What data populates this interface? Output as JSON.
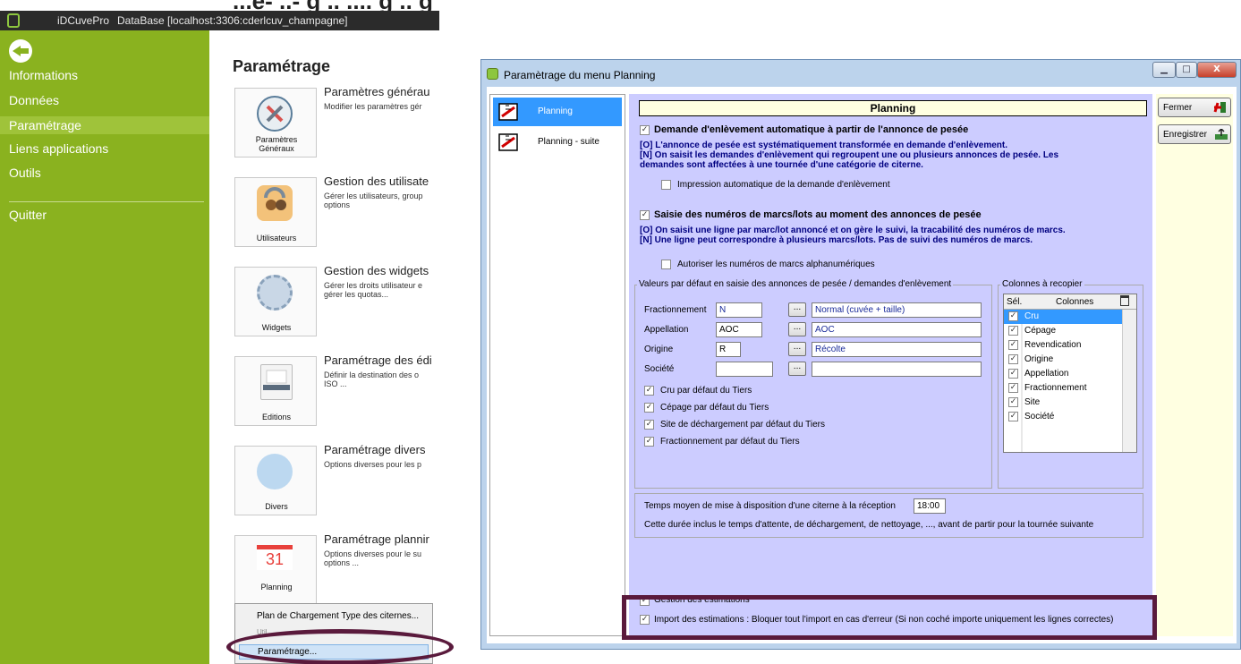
{
  "app": {
    "name": "iDCuvePro",
    "database": "DataBase [localhost:3306:cderlcuv_champagne]",
    "top_crop_text": "...e-  ..- g  ..  .... g  ..  g"
  },
  "sidebar": {
    "items": [
      {
        "label": "Informations"
      },
      {
        "label": "Données"
      },
      {
        "label": "Paramétrage"
      },
      {
        "label": "Liens applications"
      },
      {
        "label": "Outils"
      },
      {
        "label": "Quitter"
      }
    ]
  },
  "main": {
    "title": "Paramétrage",
    "sections": [
      {
        "card_label_line1": "Paramètres",
        "card_label_line2": "Généraux",
        "title": "Paramètres générau",
        "desc_line1": "Modifier les paramètres gér",
        "desc_line2": "",
        "icon": "wrench-screwdriver-icon"
      },
      {
        "card_label_line1": "Utilisateurs",
        "card_label_line2": "",
        "title": "Gestion des utilisate",
        "desc_line1": "Gérer les utilisateurs, group",
        "desc_line2": "options",
        "icon": "users-lock-icon"
      },
      {
        "card_label_line1": "Widgets",
        "card_label_line2": "",
        "title": "Gestion des widgets",
        "desc_line1": "Gérer les droits utilisateur e",
        "desc_line2": "gérer les quotas...",
        "icon": "gear-icon"
      },
      {
        "card_label_line1": "Editions",
        "card_label_line2": "",
        "title": "Paramétrage des édi",
        "desc_line1": "Définir la destination des o",
        "desc_line2": "ISO ...",
        "icon": "printer-icon"
      },
      {
        "card_label_line1": "Divers",
        "card_label_line2": "",
        "title": "Paramétrage divers",
        "desc_line1": "Options diverses pour les p",
        "desc_line2": "",
        "icon": "dots-icon"
      },
      {
        "card_label_line1": "Planning",
        "card_label_line2": "",
        "title": "Paramétrage plannir",
        "desc_line1": "Options diverses pour le su",
        "desc_line2": "options ...",
        "icon": "calendar-icon",
        "calendar_day": "31"
      }
    ],
    "context_menu": {
      "items": [
        {
          "label": "Plan de Chargement Type des citernes..."
        },
        {
          "label": "Util..."
        },
        {
          "label": "Paramétrage..."
        }
      ]
    }
  },
  "dialog": {
    "title": "Paramètrage du menu Planning",
    "window_buttons": {
      "minimize": "▁",
      "maximize": "□",
      "close": "X"
    },
    "nav": [
      {
        "label": "Planning"
      },
      {
        "label": "Planning - suite"
      }
    ],
    "panel": {
      "title": "Planning",
      "demande_auto": {
        "label": "Demande d'enlèvement automatique à partir de l'annonce de pesée",
        "checked": true,
        "note1": "[O] L'annonce de pesée est systématiquement transformée en demande d'enlèvement.",
        "note2": "[N] On saisit les demandes d'enlèvement qui regroupent une ou plusieurs annonces de pesée. Les",
        "note3": "demandes sont affectées à une tournée d'une catégorie de citerne."
      },
      "impression_auto": {
        "label": "Impression automatique de la demande d'enlèvement",
        "checked": false
      },
      "saisie_numeros": {
        "label": "Saisie des numéros de marcs/lots au moment des annonces de pesée",
        "checked": true,
        "note1": "[O] On saisit une ligne par marc/lot annoncé et on gère le suivi, la tracabilité des numéros de marcs.",
        "note2": "[N] Une ligne peut correspondre à plusieurs marcs/lots. Pas de suivi des numéros de marcs."
      },
      "alphanumeriques": {
        "label": "Autoriser les numéros de marcs alphanumériques",
        "checked": false
      },
      "defaults_group": {
        "title": "Valeurs par défaut en saisie des annonces de pesée / demandes d'enlèvement",
        "fields": [
          {
            "label": "Fractionnement",
            "code": "N",
            "button": "...",
            "desc": "Normal (cuvée + taille)"
          },
          {
            "label": "Appellation",
            "code": "AOC",
            "button": "...",
            "desc": "AOC"
          },
          {
            "label": "Origine",
            "code": "R",
            "button": "...",
            "desc": "Récolte"
          },
          {
            "label": "Société",
            "code": "",
            "button": "...",
            "desc": ""
          }
        ],
        "checks": [
          {
            "label": "Cru par défaut du Tiers",
            "checked": true
          },
          {
            "label": "Cépage par défaut du Tiers",
            "checked": true
          },
          {
            "label": "Site de déchargement par défaut du Tiers",
            "checked": true
          },
          {
            "label": "Fractionnement par défaut du Tiers",
            "checked": true
          }
        ]
      },
      "columns_group": {
        "title": "Colonnes à recopier",
        "header_sel": "Sél.",
        "header_col": "Colonnes",
        "rows": [
          {
            "name": "Cru",
            "checked": true,
            "selected": true
          },
          {
            "name": "Cépage",
            "checked": true
          },
          {
            "name": "Revendication",
            "checked": true
          },
          {
            "name": "Origine",
            "checked": true
          },
          {
            "name": "Appellation",
            "checked": true
          },
          {
            "name": "Fractionnement",
            "checked": true
          },
          {
            "name": "Site",
            "checked": true
          },
          {
            "name": "Société",
            "checked": true
          }
        ]
      },
      "temps_moyen": {
        "label": "Temps moyen de mise à disposition d'une citerne à la réception",
        "value": "18:00",
        "note": "Cette durée inclus le temps d'attente, de déchargement, de nettoyage, ..., avant de partir pour la tournée suivante"
      },
      "gestion_estimations": {
        "label": "Gestion des estimations",
        "checked": true
      },
      "import_estimations": {
        "label": "Import des estimations : Bloquer tout l'import en cas d'erreur (Si non coché importe uniquement les lignes correctes)",
        "checked": true
      }
    },
    "buttons": {
      "close": "Fermer",
      "save": "Enregistrer"
    }
  },
  "colors": {
    "sidebar_bg": "#8ab21f",
    "panel_bg": "#ccccff",
    "selection": "#3399ff",
    "note_text": "#000080",
    "highlight": "#5a1a3c"
  }
}
